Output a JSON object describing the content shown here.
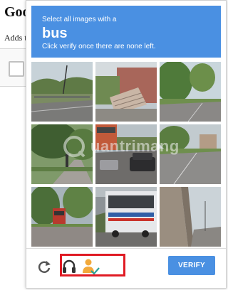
{
  "background_page": {
    "title": "Goo",
    "subtitle": "Adds th"
  },
  "captcha": {
    "instruction_line1": "Select all images with a",
    "target_word": "bus",
    "instruction_line2": "Click verify once there are none left.",
    "verify_label": "VERIFY",
    "accent_color": "#4a90e2",
    "highlight_color": "#e01b24",
    "watermark_text": "uantrimang",
    "icons": {
      "reload": "reload-icon",
      "audio": "headphones-icon",
      "vision": "person-check-icon"
    },
    "tiles": [
      {
        "name": "tile-1",
        "scene": "street with fence and trees"
      },
      {
        "name": "tile-2",
        "scene": "brick building steps"
      },
      {
        "name": "tile-3",
        "scene": "tree-lined street"
      },
      {
        "name": "tile-4",
        "scene": "park with cyclist"
      },
      {
        "name": "tile-5",
        "scene": "street with cars"
      },
      {
        "name": "tile-6",
        "scene": "residential road"
      },
      {
        "name": "tile-7",
        "scene": "street with red bus"
      },
      {
        "name": "tile-8",
        "scene": "city bus"
      },
      {
        "name": "tile-9",
        "scene": "sky and building"
      }
    ]
  }
}
